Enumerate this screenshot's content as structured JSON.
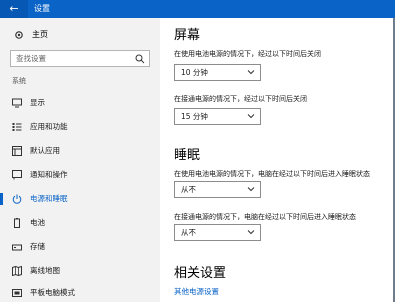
{
  "window": {
    "title": "设置"
  },
  "sidebar": {
    "home_label": "主页",
    "search_placeholder": "查找设置",
    "section_label": "系统",
    "items": [
      {
        "label": "显示",
        "icon": "monitor-icon"
      },
      {
        "label": "应用和功能",
        "icon": "app-list-icon"
      },
      {
        "label": "默认应用",
        "icon": "default-apps-icon"
      },
      {
        "label": "通知和操作",
        "icon": "notifications-icon"
      },
      {
        "label": "电源和睡眠",
        "icon": "power-icon",
        "active": true
      },
      {
        "label": "电池",
        "icon": "battery-icon"
      },
      {
        "label": "存储",
        "icon": "storage-icon"
      },
      {
        "label": "离线地图",
        "icon": "offline-maps-icon"
      },
      {
        "label": "平板电脑模式",
        "icon": "tablet-mode-icon"
      }
    ]
  },
  "main": {
    "screen": {
      "heading": "屏幕",
      "battery_label": "在使用电池电源的情况下，经过以下时间后关闭",
      "battery_value": "10 分钟",
      "plugged_label": "在接通电源的情况下，经过以下时间后关闭",
      "plugged_value": "15 分钟"
    },
    "sleep": {
      "heading": "睡眠",
      "battery_label": "在使用电池电源的情况下，电脑在经过以下时间后进入睡眠状态",
      "battery_value": "从不",
      "plugged_label": "在接通电源的情况下，电脑在经过以下时间后进入睡眠状态",
      "plugged_value": "从不"
    },
    "related": {
      "heading": "相关设置",
      "link": "其他电源设置"
    }
  },
  "colors": {
    "accent": "#0a63c7",
    "sidebar_bg": "#f2f2f2",
    "titlebar": "#0a63c7"
  }
}
